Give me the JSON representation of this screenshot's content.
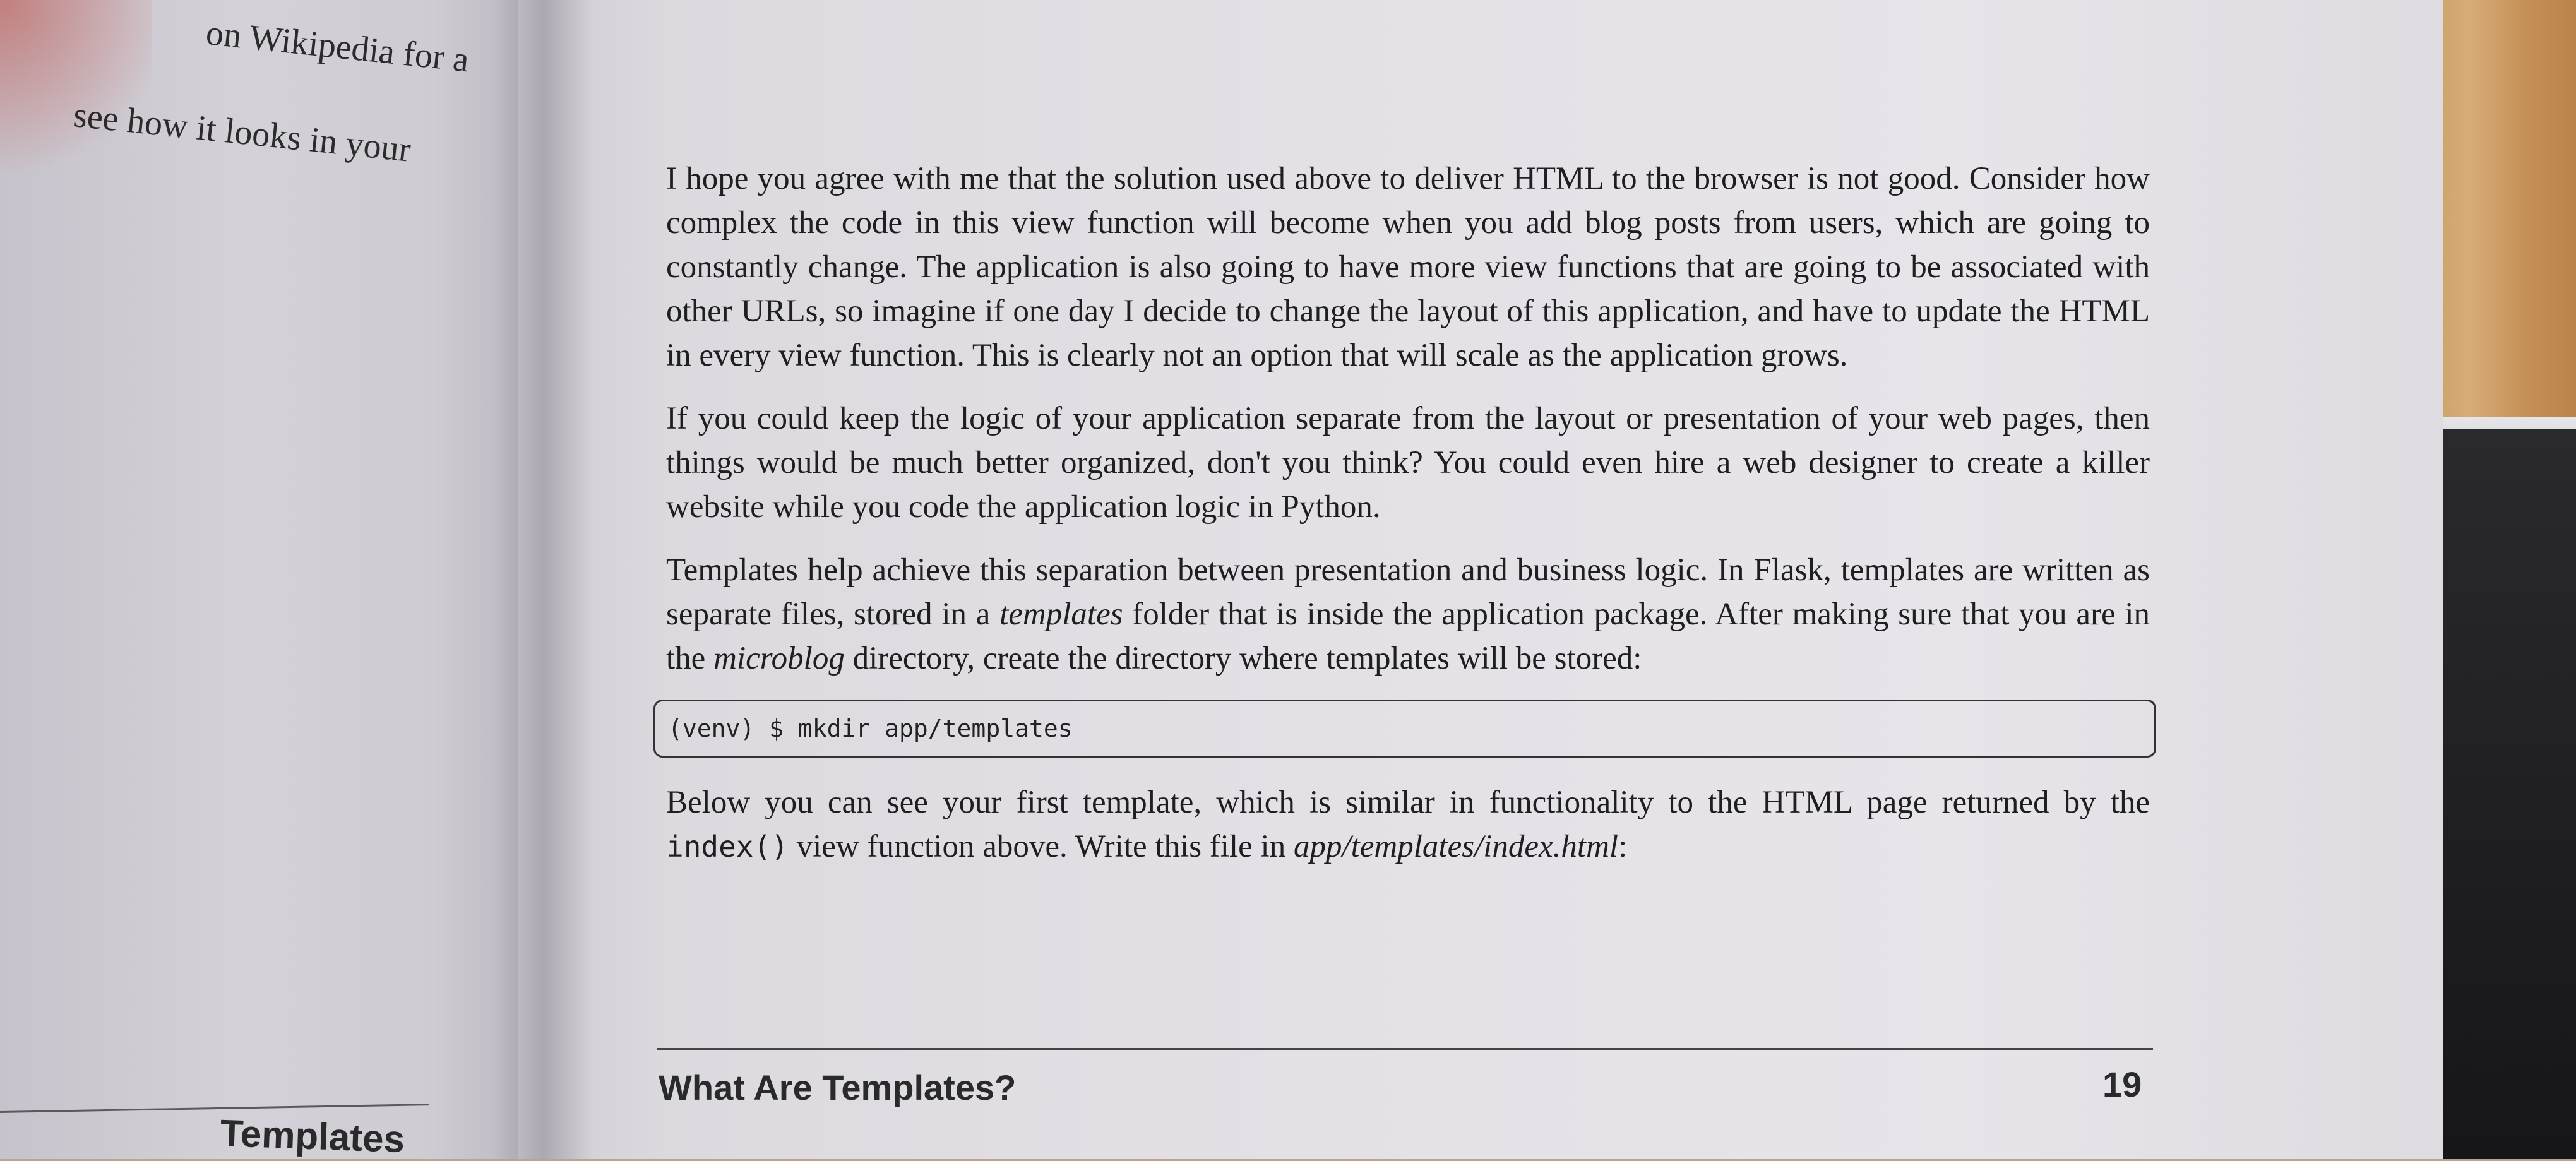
{
  "left_page": {
    "line_1": "on Wikipedia for a",
    "line_2": "see how it looks in your",
    "footer": "Templates"
  },
  "right_page": {
    "paragraphs": [
      "I hope you agree with me that the solution used above to deliver HTML to the browser is not good. Consider how complex the code in this view function will become when you add blog posts from users, which are going to constantly change. The application is also going to have more view functions that are going to be associated with other URLs, so imagine if one day I decide to change the layout of this application, and have to update the HTML in every view function. This is clearly not an option that will scale as the application grows.",
      "If you could keep the logic of your application separate from the layout or presentation of your web pages, then things would be much better organized, don't you think? You could even hire a web designer to create a killer website while you code the application logic in Python."
    ],
    "para3": {
      "part1": "Templates help achieve this separation between presentation and business logic. In Flask, templates are written as separate files, stored in a ",
      "em1": "templates",
      "part2": " folder that is inside the application package. After making sure that you are in the ",
      "em2": "microblog",
      "part3": " directory, create the directory where templates will be stored:"
    },
    "code": "(venv) $ mkdir app/templates",
    "para4": {
      "part1": "Below you can see your first template, which is similar in functionality to the HTML page returned by the ",
      "code": "index()",
      "part2": " view function above. Write this file in ",
      "em": "app/templates/index.html",
      "part3": ":"
    },
    "footer_title": "What Are Templates?",
    "page_number": "19"
  }
}
